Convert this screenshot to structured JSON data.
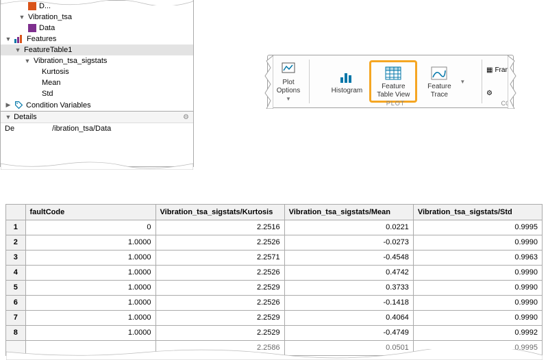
{
  "tree": {
    "data0_label": "D...",
    "vibration_tsa": "Vibration_tsa",
    "data_label": "Data",
    "features": "Features",
    "feature_table1": "FeatureTable1",
    "sigstats": "Vibration_tsa_sigstats",
    "kurtosis": "Kurtosis",
    "mean": "Mean",
    "std": "Std",
    "condition_variables": "Condition Variables",
    "details": "Details",
    "details_path": "/ibration_tsa/Data",
    "details_prefix": "De"
  },
  "toolbar": {
    "plot_options": "Plot\nOptions",
    "histogram": "Histogram",
    "feature_table_view": "Feature\nTable View",
    "feature_trace": "Feature\nTrace",
    "section_label": "PLOT",
    "frame": "Fran",
    "co": "CO"
  },
  "table": {
    "headers": {
      "row": "",
      "fault": "faultCode",
      "kurt": "Vibration_tsa_sigstats/Kurtosis",
      "mean": "Vibration_tsa_sigstats/Mean",
      "std": "Vibration_tsa_sigstats/Std"
    },
    "rows": [
      {
        "n": "1",
        "fault": "0",
        "kurt": "2.2516",
        "mean": "0.0221",
        "std": "0.9995"
      },
      {
        "n": "2",
        "fault": "1.0000",
        "kurt": "2.2526",
        "mean": "-0.0273",
        "std": "0.9990"
      },
      {
        "n": "3",
        "fault": "1.0000",
        "kurt": "2.2571",
        "mean": "-0.4548",
        "std": "0.9963"
      },
      {
        "n": "4",
        "fault": "1.0000",
        "kurt": "2.2526",
        "mean": "0.4742",
        "std": "0.9990"
      },
      {
        "n": "5",
        "fault": "1.0000",
        "kurt": "2.2529",
        "mean": "0.3733",
        "std": "0.9990"
      },
      {
        "n": "6",
        "fault": "1.0000",
        "kurt": "2.2526",
        "mean": "-0.1418",
        "std": "0.9990"
      },
      {
        "n": "7",
        "fault": "1.0000",
        "kurt": "2.2529",
        "mean": "0.4064",
        "std": "0.9990"
      },
      {
        "n": "8",
        "fault": "1.0000",
        "kurt": "2.2529",
        "mean": "-0.4749",
        "std": "0.9992"
      }
    ],
    "partial_row": {
      "kurt": "2.2586",
      "mean": "0.0501",
      "std": "0.9995"
    }
  }
}
